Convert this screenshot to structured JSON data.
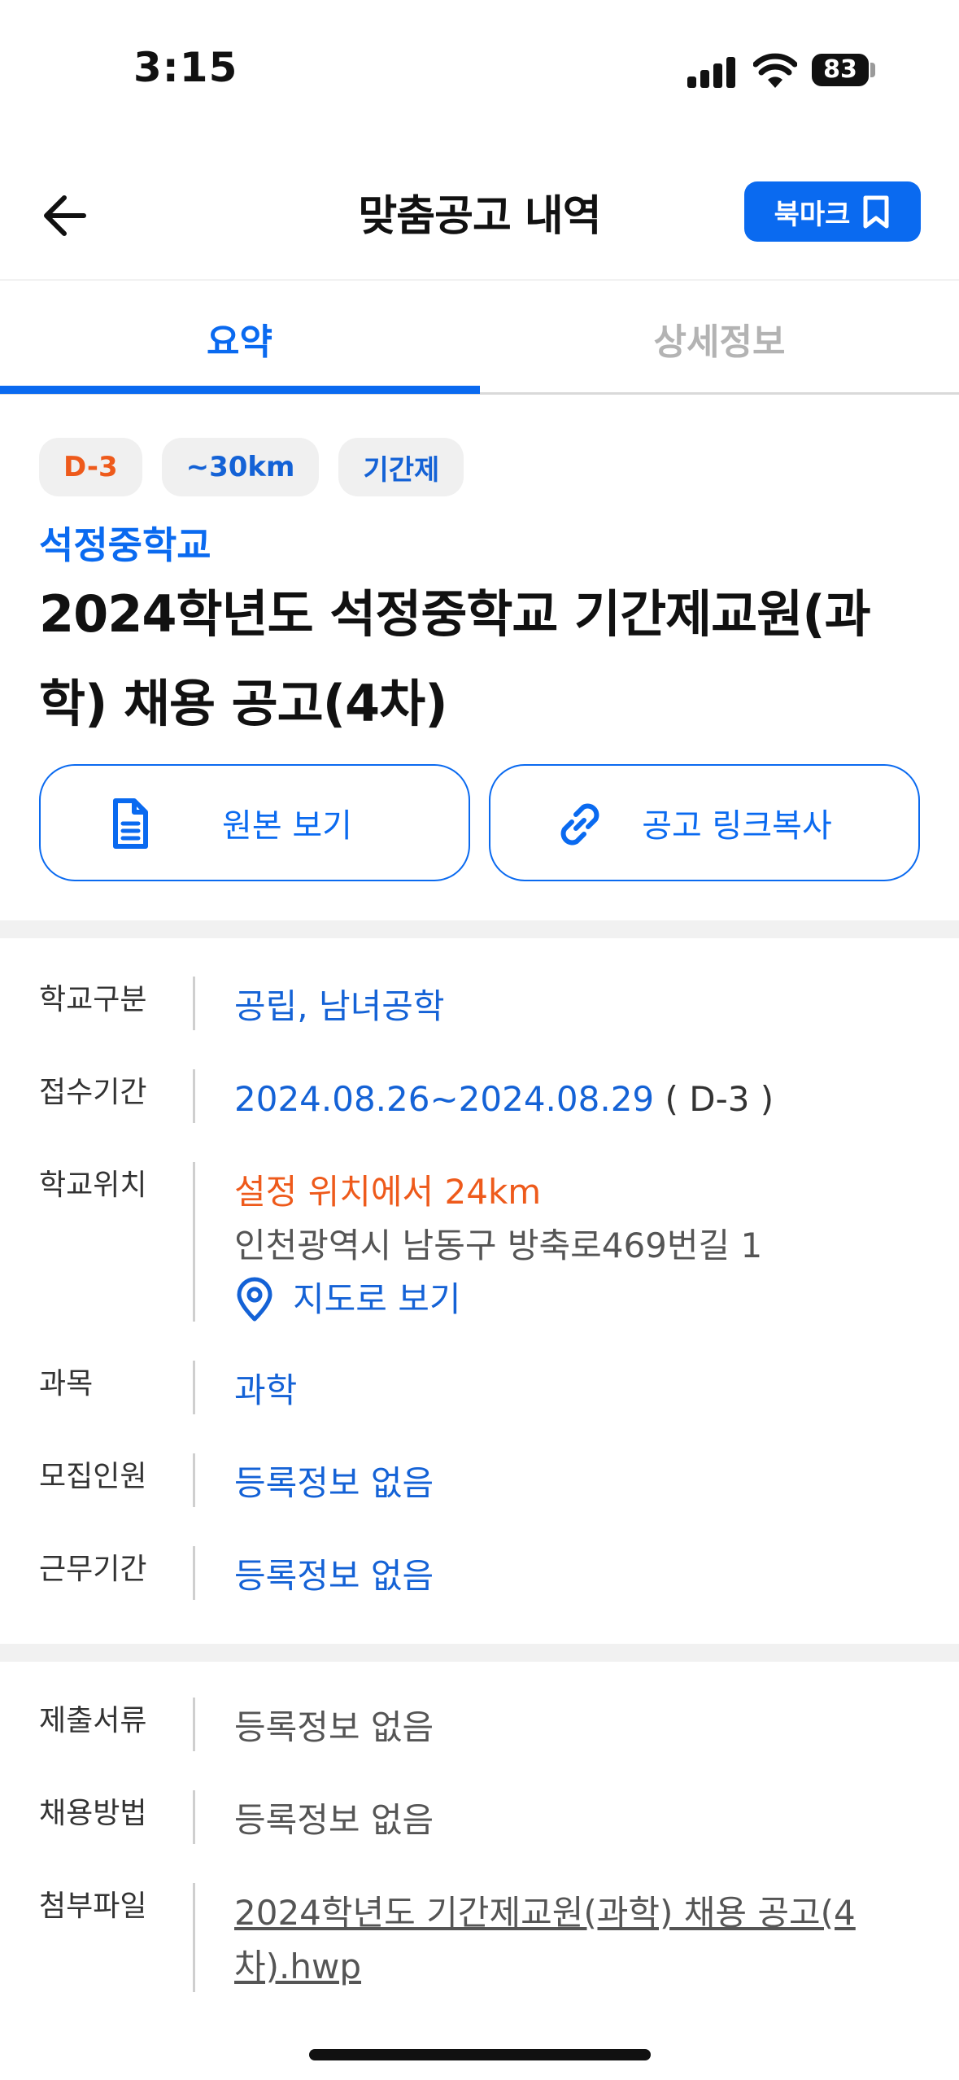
{
  "status_bar": {
    "time": "3:15",
    "battery": "83"
  },
  "header": {
    "title": "맞춤공고 내역",
    "bookmark_label": "북마크"
  },
  "tabs": [
    {
      "label": "요약",
      "active": true
    },
    {
      "label": "상세정보",
      "active": false
    }
  ],
  "chips": {
    "dday": "D-3",
    "distance": "~30km",
    "type": "기간제"
  },
  "school_name": "석정중학교",
  "job_title": "2024학년도 석정중학교 기간제교원(과학) 채용 공고(4차)",
  "actions": {
    "original": "원본 보기",
    "copy_link": "공고 링크복사"
  },
  "info": {
    "school_type": {
      "label": "학교구분",
      "value": "공립, 남녀공학"
    },
    "period": {
      "label": "접수기간",
      "value": "2024.08.26~2024.08.29",
      "dday": "( D-3 )"
    },
    "location": {
      "label": "학교위치",
      "distance": "설정 위치에서 24km",
      "address": "인천광역시 남동구 방축로469번길 1",
      "map_link": "지도로 보기"
    },
    "subject": {
      "label": "과목",
      "value": "과학"
    },
    "headcount": {
      "label": "모집인원",
      "value": "등록정보 없음"
    },
    "work_period": {
      "label": "근무기간",
      "value": "등록정보 없음"
    }
  },
  "extra": {
    "documents": {
      "label": "제출서류",
      "value": "등록정보 없음"
    },
    "method": {
      "label": "채용방법",
      "value": "등록정보 없음"
    },
    "attachment": {
      "label": "첨부파일",
      "value": "2024학년도 기간제교원(과학) 채용 공고(4차).hwp"
    }
  },
  "colors": {
    "accent": "#0a6af0",
    "dday": "#ee5a1b",
    "divider": "#f1f1f1"
  }
}
